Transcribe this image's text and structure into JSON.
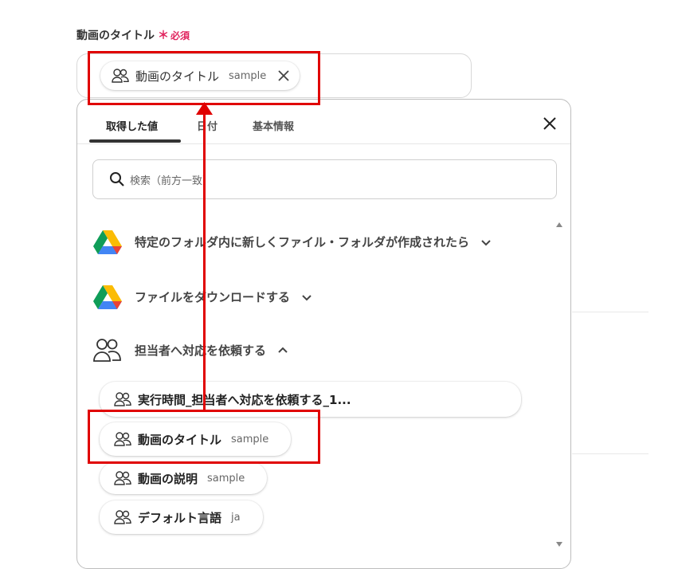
{
  "field": {
    "label": "動画のタイトル",
    "required_mark": "＊",
    "required_text": "必須",
    "selected_chip": {
      "name": "動画のタイトル",
      "value": "sample"
    }
  },
  "dropdown": {
    "tabs": [
      {
        "label": "取得した値",
        "active": true
      },
      {
        "label": "日付",
        "active": false
      },
      {
        "label": "基本情報",
        "active": false
      }
    ],
    "search_placeholder": "検索（前方一致）",
    "groups": [
      {
        "title": "特定のフォルダ内に新しくファイル・フォルダが作成されたら",
        "icon": "google-drive-icon",
        "expanded": false
      },
      {
        "title": "ファイルをダウンロードする",
        "icon": "google-drive-icon",
        "expanded": false
      },
      {
        "title": "担当者へ対応を依頼する",
        "icon": "users-icon",
        "expanded": true
      }
    ],
    "items": [
      {
        "name": "実行時間_担当者へ対応を依頼する_1...",
        "value": ""
      },
      {
        "name": "動画のタイトル",
        "value": "sample"
      },
      {
        "name": "動画の説明",
        "value": "sample"
      },
      {
        "name": "デフォルト言語",
        "value": "ja"
      }
    ]
  },
  "colors": {
    "annotation": "#e00000",
    "required": "#e0245e"
  }
}
